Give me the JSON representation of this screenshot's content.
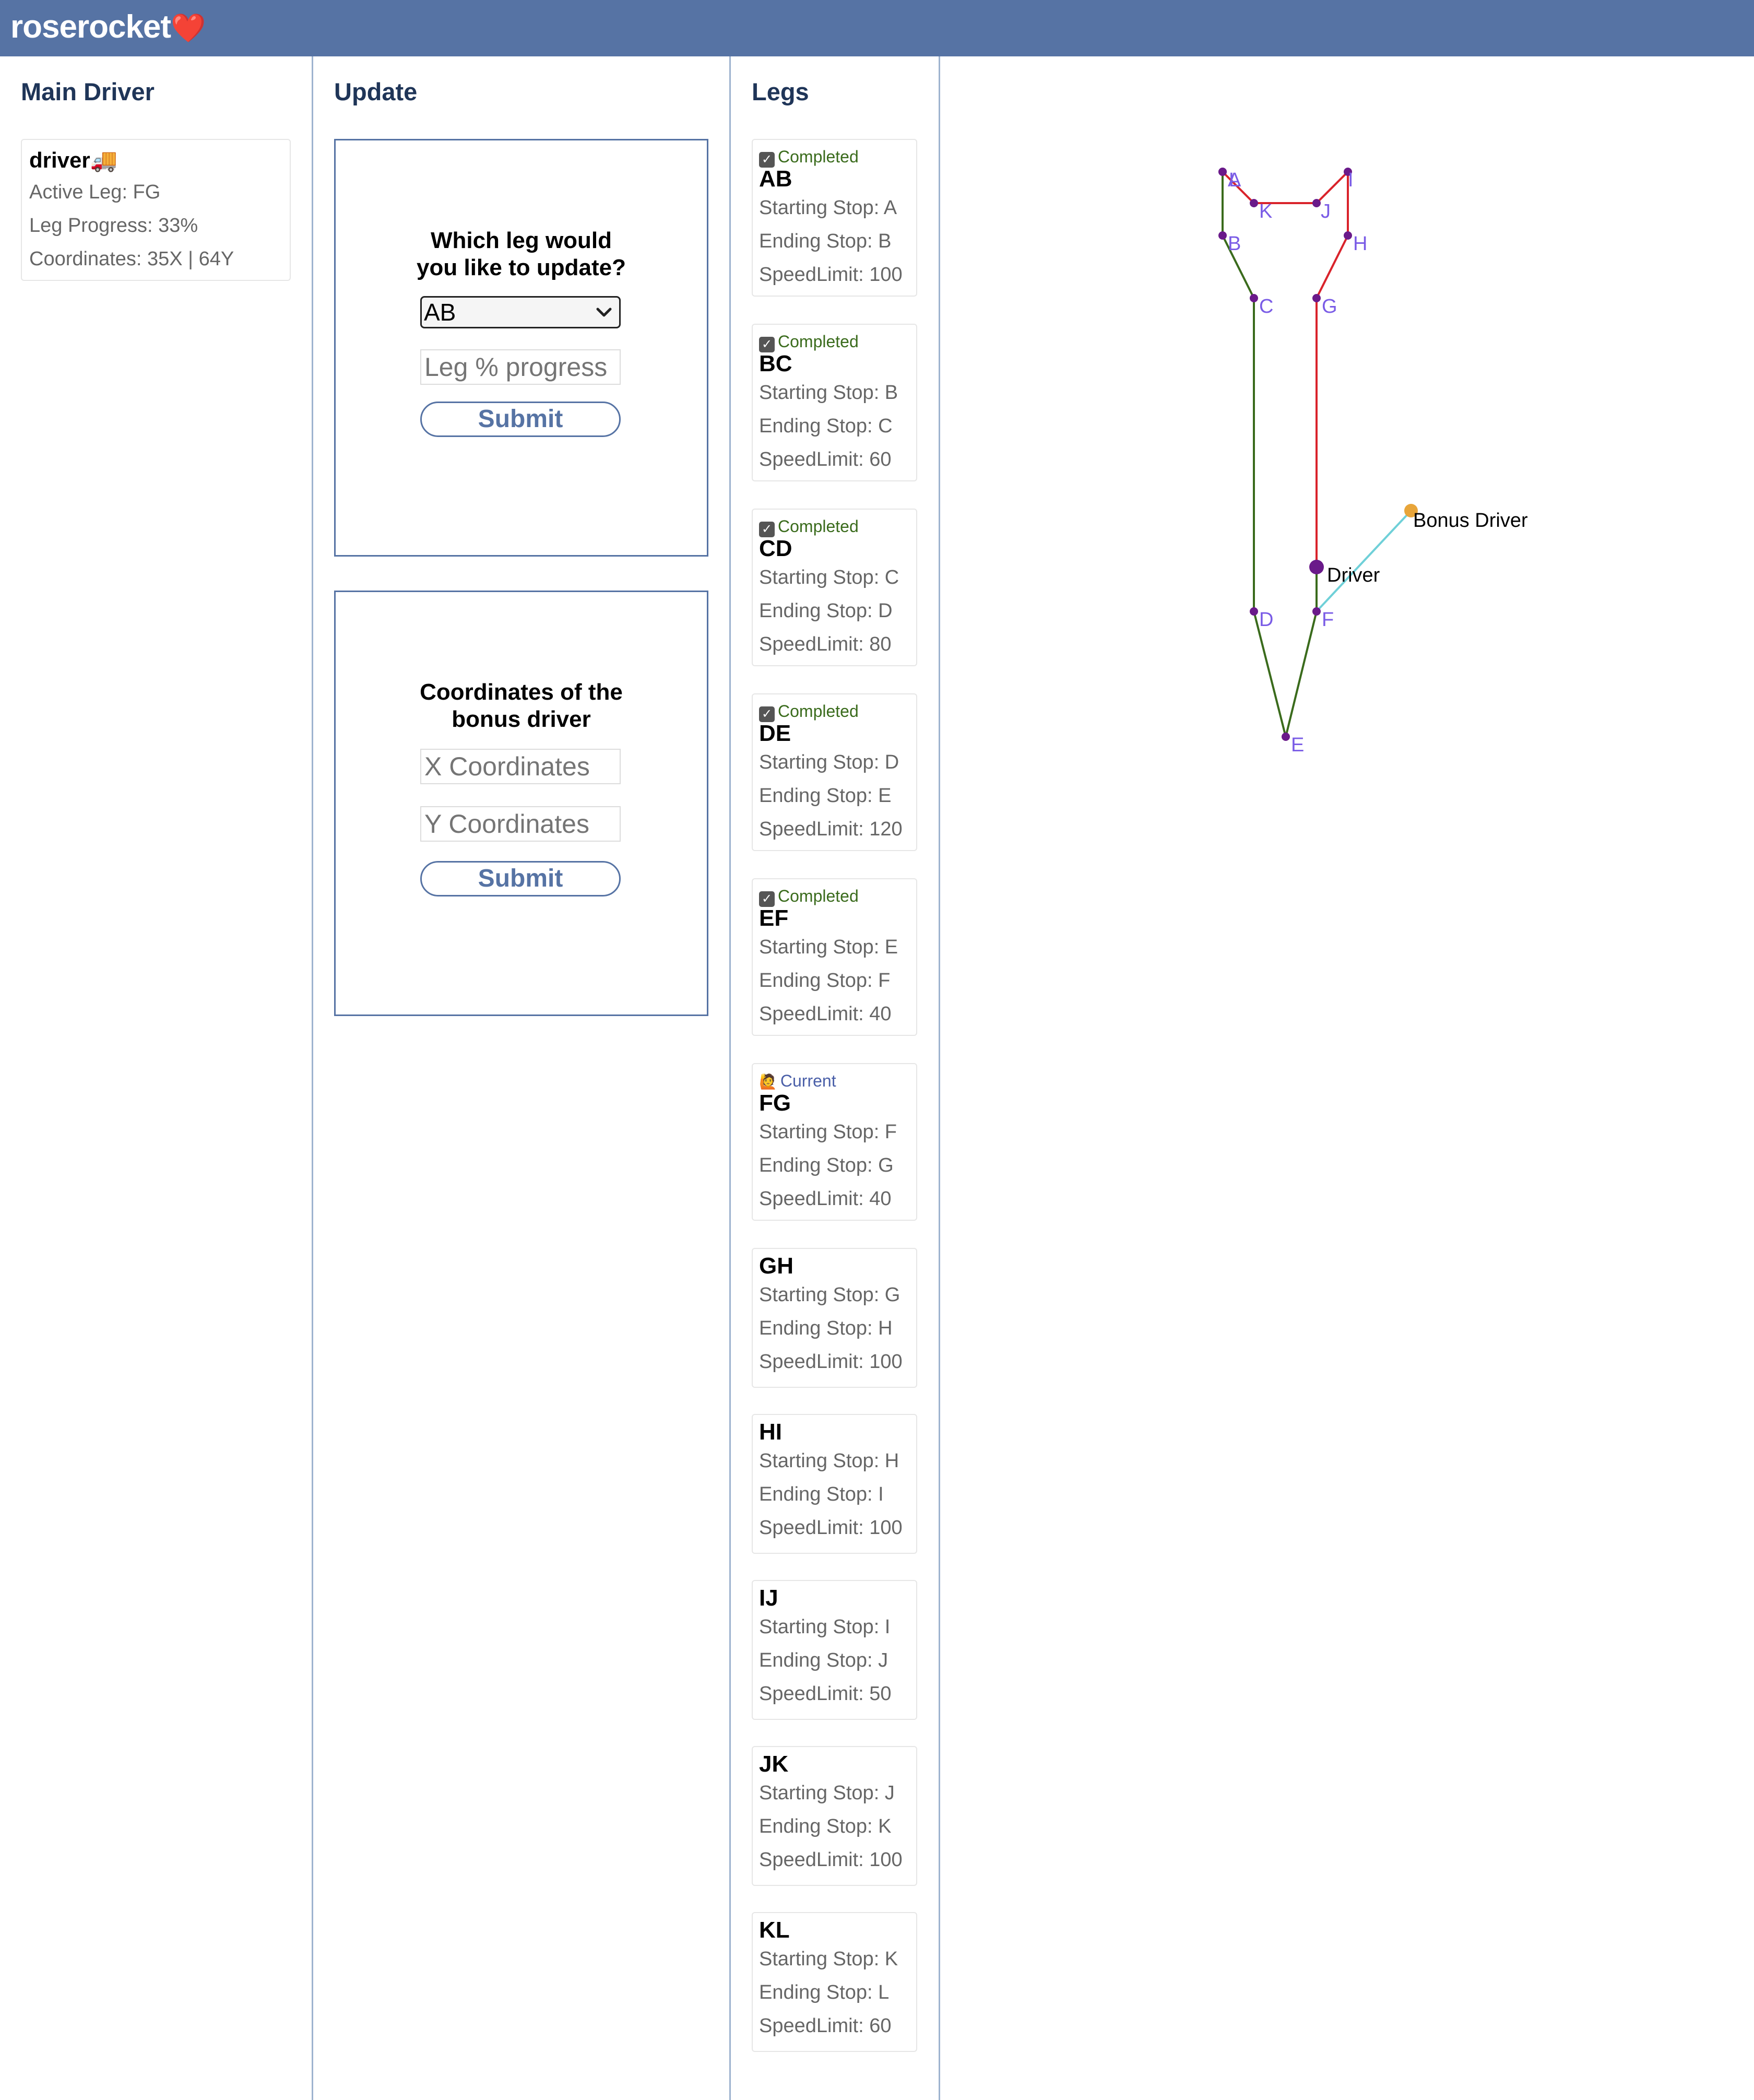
{
  "app": {
    "brand": "roserocket",
    "heart": "❤️"
  },
  "driver_panel": {
    "title": "Main Driver",
    "name": "driver",
    "truck": "🚚",
    "active_leg": "Active Leg: FG",
    "leg_progress": "Leg Progress: 33%",
    "coordinates": "Coordinates: 35X | 64Y"
  },
  "update_panel": {
    "title": "Update",
    "leg_form": {
      "question_line1": "Which leg would",
      "question_line2": "you like to update?",
      "selected_leg": "AB",
      "progress_placeholder": "Leg % progress",
      "submit_label": "Submit"
    },
    "bonus_form": {
      "title_line1": "Coordinates of the",
      "title_line2": "bonus driver",
      "x_placeholder": "X Coordinates",
      "y_placeholder": "Y Coordinates",
      "submit_label": "Submit"
    }
  },
  "legs_panel": {
    "title": "Legs",
    "legs": [
      {
        "name": "AB",
        "status": "Completed",
        "start": "Starting Stop: A",
        "end": "Ending Stop: B",
        "speed": "SpeedLimit: 100"
      },
      {
        "name": "BC",
        "status": "Completed",
        "start": "Starting Stop: B",
        "end": "Ending Stop: C",
        "speed": "SpeedLimit: 60"
      },
      {
        "name": "CD",
        "status": "Completed",
        "start": "Starting Stop: C",
        "end": "Ending Stop: D",
        "speed": "SpeedLimit: 80"
      },
      {
        "name": "DE",
        "status": "Completed",
        "start": "Starting Stop: D",
        "end": "Ending Stop: E",
        "speed": "SpeedLimit: 120"
      },
      {
        "name": "EF",
        "status": "Completed",
        "start": "Starting Stop: E",
        "end": "Ending Stop: F",
        "speed": "SpeedLimit: 40"
      },
      {
        "name": "FG",
        "status": "Current",
        "start": "Starting Stop: F",
        "end": "Ending Stop: G",
        "speed": "SpeedLimit: 40"
      },
      {
        "name": "GH",
        "status": "",
        "start": "Starting Stop: G",
        "end": "Ending Stop: H",
        "speed": "SpeedLimit: 100"
      },
      {
        "name": "HI",
        "status": "",
        "start": "Starting Stop: H",
        "end": "Ending Stop: I",
        "speed": "SpeedLimit: 100"
      },
      {
        "name": "IJ",
        "status": "",
        "start": "Starting Stop: I",
        "end": "Ending Stop: J",
        "speed": "SpeedLimit: 50"
      },
      {
        "name": "JK",
        "status": "",
        "start": "Starting Stop: J",
        "end": "Ending Stop: K",
        "speed": "SpeedLimit: 100"
      },
      {
        "name": "KL",
        "status": "",
        "start": "Starting Stop: K",
        "end": "Ending Stop: L",
        "speed": "SpeedLimit: 60"
      }
    ]
  },
  "map": {
    "stop_labels": [
      "A",
      "B",
      "C",
      "D",
      "E",
      "F",
      "G",
      "H",
      "I",
      "J",
      "K",
      "L"
    ],
    "driver_label": "Driver",
    "bonus_driver_label": "Bonus Driver",
    "colors": {
      "completed": "#3a6b1c",
      "pending": "#d9232b",
      "bonus_link": "#6fd0d8",
      "stop_dot": "#6a1a8a",
      "stop_label": "#7a5ce6",
      "bonus_dot": "#e8a53a"
    }
  }
}
